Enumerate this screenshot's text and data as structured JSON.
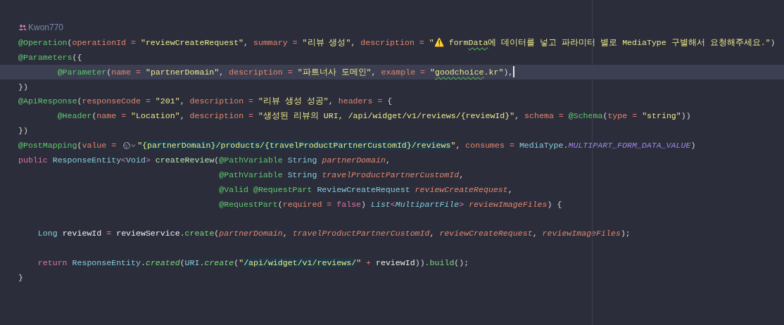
{
  "editor": {
    "lines": [
      {
        "kind": "author",
        "author": "Kwon770"
      },
      {
        "tokens": [
          {
            "text": "@Operation",
            "kind": "annotation"
          },
          {
            "text": "(",
            "kind": "punct"
          },
          {
            "text": "operationId",
            "kind": "param"
          },
          {
            "text": " = ",
            "kind": "op"
          },
          {
            "text": "\"reviewCreateRequest\"",
            "kind": "string"
          },
          {
            "text": ", ",
            "kind": "punct"
          },
          {
            "text": "summary",
            "kind": "param"
          },
          {
            "text": " = ",
            "kind": "op"
          },
          {
            "text": "\"리뷰 생성\"",
            "kind": "string"
          },
          {
            "text": ", ",
            "kind": "punct"
          },
          {
            "text": "description",
            "kind": "param"
          },
          {
            "text": " = ",
            "kind": "op"
          },
          {
            "text": "\"⚠️ form",
            "kind": "string"
          },
          {
            "text": "Data",
            "kind": "string",
            "typo": true
          },
          {
            "text": "에 데이터를 넣고 파라미터 별로 MediaType 구별해서 요청해주세요.\"",
            "kind": "string"
          },
          {
            "text": ")",
            "kind": "punct"
          }
        ]
      },
      {
        "tokens": [
          {
            "text": "@Parameters",
            "kind": "annotation"
          },
          {
            "text": "({",
            "kind": "punct"
          }
        ]
      },
      {
        "current": true,
        "cursor": true,
        "tokens": [
          {
            "text": "        @Parameter",
            "kind": "annotation"
          },
          {
            "text": "(",
            "kind": "punct"
          },
          {
            "text": "name",
            "kind": "param"
          },
          {
            "text": " = ",
            "kind": "op"
          },
          {
            "text": "\"partnerDomain\"",
            "kind": "string"
          },
          {
            "text": ", ",
            "kind": "punct"
          },
          {
            "text": "description",
            "kind": "param"
          },
          {
            "text": " = ",
            "kind": "op"
          },
          {
            "text": "\"파트너사 도메인\"",
            "kind": "string"
          },
          {
            "text": ", ",
            "kind": "punct"
          },
          {
            "text": "example",
            "kind": "param"
          },
          {
            "text": " = ",
            "kind": "op"
          },
          {
            "text": "\"",
            "kind": "string"
          },
          {
            "text": "goodchoice",
            "kind": "string",
            "typo": true
          },
          {
            "text": ".kr\"",
            "kind": "string"
          },
          {
            "text": "),",
            "kind": "punct"
          }
        ]
      },
      {
        "tokens": [
          {
            "text": "})",
            "kind": "punct"
          }
        ]
      },
      {
        "tokens": [
          {
            "text": "@ApiResponse",
            "kind": "annotation"
          },
          {
            "text": "(",
            "kind": "punct"
          },
          {
            "text": "responseCode",
            "kind": "param"
          },
          {
            "text": " = ",
            "kind": "op"
          },
          {
            "text": "\"201\"",
            "kind": "string"
          },
          {
            "text": ", ",
            "kind": "punct"
          },
          {
            "text": "description",
            "kind": "param"
          },
          {
            "text": " = ",
            "kind": "op"
          },
          {
            "text": "\"리뷰 생성 성공\"",
            "kind": "string"
          },
          {
            "text": ", ",
            "kind": "punct"
          },
          {
            "text": "headers",
            "kind": "param"
          },
          {
            "text": " = ",
            "kind": "op"
          },
          {
            "text": "{",
            "kind": "punct"
          }
        ]
      },
      {
        "tokens": [
          {
            "text": "        @Header",
            "kind": "annotation"
          },
          {
            "text": "(",
            "kind": "punct"
          },
          {
            "text": "name",
            "kind": "param"
          },
          {
            "text": " = ",
            "kind": "op"
          },
          {
            "text": "\"Location\"",
            "kind": "string"
          },
          {
            "text": ", ",
            "kind": "punct"
          },
          {
            "text": "description",
            "kind": "param"
          },
          {
            "text": " = ",
            "kind": "op"
          },
          {
            "text": "\"생성된 리뷰의 URI, /api/widget/v1/reviews/{reviewId}\"",
            "kind": "string"
          },
          {
            "text": ", ",
            "kind": "punct"
          },
          {
            "text": "schema",
            "kind": "param"
          },
          {
            "text": " = ",
            "kind": "op"
          },
          {
            "text": "@Schema",
            "kind": "annotation"
          },
          {
            "text": "(",
            "kind": "punct"
          },
          {
            "text": "type",
            "kind": "param"
          },
          {
            "text": " = ",
            "kind": "op"
          },
          {
            "text": "\"string\"",
            "kind": "string"
          },
          {
            "text": "))",
            "kind": "punct"
          }
        ]
      },
      {
        "tokens": [
          {
            "text": "})",
            "kind": "punct"
          }
        ]
      },
      {
        "tokens": [
          {
            "text": "@PostMapping",
            "kind": "annotation"
          },
          {
            "text": "(",
            "kind": "punct"
          },
          {
            "text": "value",
            "kind": "param"
          },
          {
            "text": " = ",
            "kind": "op"
          },
          {
            "kind": "web-reference"
          },
          {
            "text": "\"",
            "kind": "string"
          },
          {
            "text": "{partnerDomain}/products/{travelProductPartnerCustomId}/reviews",
            "kind": "string",
            "injected": true
          },
          {
            "text": "\"",
            "kind": "string"
          },
          {
            "text": ", ",
            "kind": "punct"
          },
          {
            "text": "consumes",
            "kind": "param"
          },
          {
            "text": " = ",
            "kind": "op"
          },
          {
            "text": "MediaType",
            "kind": "type"
          },
          {
            "text": ".",
            "kind": "punct"
          },
          {
            "text": "MULTIPART_FORM_DATA_VALUE",
            "kind": "const"
          },
          {
            "text": ")",
            "kind": "punct"
          }
        ]
      },
      {
        "tokens": [
          {
            "text": "public ",
            "kind": "keyword"
          },
          {
            "text": "ResponseEntity",
            "kind": "type"
          },
          {
            "text": "<",
            "kind": "generic"
          },
          {
            "text": "Void",
            "kind": "type"
          },
          {
            "text": ">",
            "kind": "generic"
          },
          {
            "text": " createReview",
            "kind": "decl"
          },
          {
            "text": "(",
            "kind": "punct"
          },
          {
            "text": "@PathVariable",
            "kind": "annotation"
          },
          {
            "text": " String ",
            "kind": "type"
          },
          {
            "text": "partnerDomain",
            "kind": "var"
          },
          {
            "text": ",",
            "kind": "punct"
          }
        ]
      },
      {
        "tokens": [
          {
            "text": "                                         @PathVariable",
            "kind": "annotation"
          },
          {
            "text": " String ",
            "kind": "type"
          },
          {
            "text": "travelProductPartnerCustomId",
            "kind": "var"
          },
          {
            "text": ",",
            "kind": "punct"
          }
        ]
      },
      {
        "tokens": [
          {
            "text": "                                         @Valid @RequestPart",
            "kind": "annotation"
          },
          {
            "text": " ReviewCreateRequest ",
            "kind": "type"
          },
          {
            "text": "reviewCreateRequest",
            "kind": "var"
          },
          {
            "text": ",",
            "kind": "punct"
          }
        ]
      },
      {
        "tokens": [
          {
            "text": "                                         @RequestPart",
            "kind": "annotation"
          },
          {
            "text": "(",
            "kind": "punct"
          },
          {
            "text": "required",
            "kind": "param"
          },
          {
            "text": " = ",
            "kind": "op"
          },
          {
            "text": "false",
            "kind": "keyword"
          },
          {
            "text": ") ",
            "kind": "punct"
          },
          {
            "text": "List",
            "kind": "type-italic"
          },
          {
            "text": "<",
            "kind": "generic"
          },
          {
            "text": "MultipartFile",
            "kind": "type-italic"
          },
          {
            "text": ">",
            "kind": "generic"
          },
          {
            "text": " reviewImageFiles",
            "kind": "var"
          },
          {
            "text": ") {",
            "kind": "punct"
          }
        ]
      },
      {
        "kind": "blank"
      },
      {
        "tokens": [
          {
            "text": "    Long",
            "kind": "type"
          },
          {
            "text": " reviewId",
            "kind": "local"
          },
          {
            "text": " = ",
            "kind": "op"
          },
          {
            "text": "reviewService",
            "kind": "local"
          },
          {
            "text": ".",
            "kind": "punct"
          },
          {
            "text": "create",
            "kind": "call"
          },
          {
            "text": "(",
            "kind": "punct"
          },
          {
            "text": "partnerDomain",
            "kind": "var"
          },
          {
            "text": ", ",
            "kind": "punct"
          },
          {
            "text": "travelProductPartnerCustomId",
            "kind": "var"
          },
          {
            "text": ", ",
            "kind": "punct"
          },
          {
            "text": "reviewCreateRequest",
            "kind": "var"
          },
          {
            "text": ", ",
            "kind": "punct"
          },
          {
            "text": "reviewImageFiles",
            "kind": "var"
          },
          {
            "text": ");",
            "kind": "punct"
          }
        ]
      },
      {
        "kind": "blank"
      },
      {
        "tokens": [
          {
            "text": "    return",
            "kind": "keyword"
          },
          {
            "text": " ResponseEntity",
            "kind": "type"
          },
          {
            "text": ".",
            "kind": "punct"
          },
          {
            "text": "created",
            "kind": "call-italic"
          },
          {
            "text": "(",
            "kind": "punct"
          },
          {
            "text": "URI",
            "kind": "type"
          },
          {
            "text": ".",
            "kind": "punct"
          },
          {
            "text": "create",
            "kind": "call-italic"
          },
          {
            "text": "(",
            "kind": "punct"
          },
          {
            "text": "\"",
            "kind": "string"
          },
          {
            "text": "/api/widget/v1/reviews/",
            "kind": "string",
            "injected": true
          },
          {
            "text": "\"",
            "kind": "string"
          },
          {
            "text": " + ",
            "kind": "op"
          },
          {
            "text": "reviewId",
            "kind": "local"
          },
          {
            "text": ")).",
            "kind": "punct"
          },
          {
            "text": "build",
            "kind": "call"
          },
          {
            "text": "();",
            "kind": "punct"
          }
        ]
      },
      {
        "tokens": [
          {
            "text": "}",
            "kind": "punct"
          }
        ]
      }
    ]
  }
}
